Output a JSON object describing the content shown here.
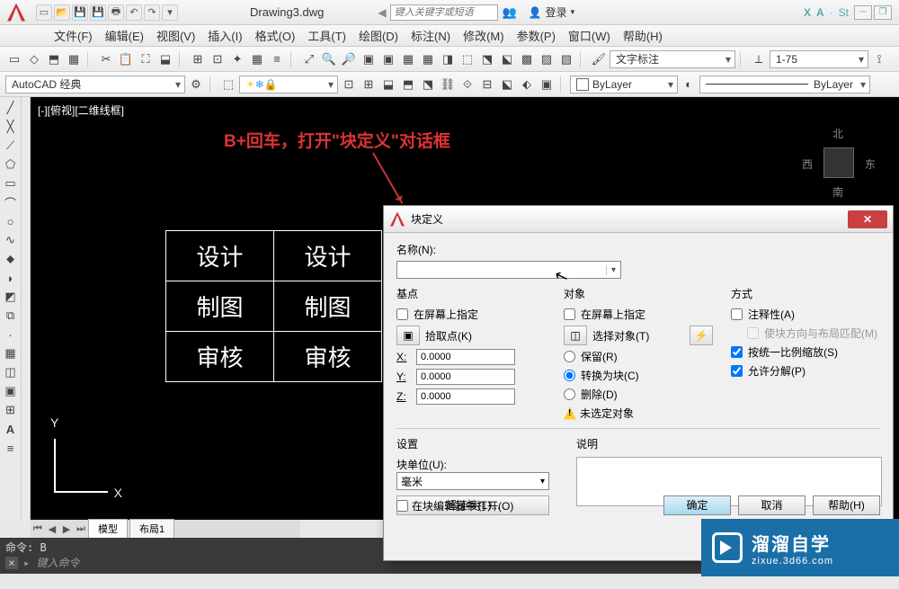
{
  "titlebar": {
    "filename": "Drawing3.dwg",
    "search_placeholder": "键入关键字或短语",
    "login": "登录",
    "exchange_x": "X",
    "exchange_a": "A",
    "sign": "St"
  },
  "menu": {
    "file": "文件(F)",
    "edit": "编辑(E)",
    "view": "视图(V)",
    "insert": "插入(I)",
    "format": "格式(O)",
    "tools": "工具(T)",
    "draw": "绘图(D)",
    "dimension": "标注(N)",
    "modify": "修改(M)",
    "param": "参数(P)",
    "window": "窗口(W)",
    "help": "帮助(H)"
  },
  "workspace": "AutoCAD 经典",
  "textstyle": "文字标注",
  "dimscale": "1-75",
  "layerprops": {
    "bylayer": "ByLayer",
    "linetype": "ByLayer"
  },
  "canvas": {
    "viewlabel": "[-][俯视][二维线框]",
    "redtext": "B+回车，打开\"块定义\"对话框",
    "table": [
      [
        "设计",
        "设计"
      ],
      [
        "制图",
        "制图"
      ],
      [
        "审核",
        "审核"
      ]
    ],
    "axis_y": "Y",
    "axis_x": "X",
    "viewcube": {
      "n": "北",
      "s": "南",
      "e": "东",
      "w": "西"
    }
  },
  "modeltabs": {
    "model": "模型",
    "layout1": "布局1"
  },
  "cmdline": {
    "line1": "命令: B",
    "prompt": "键入命令"
  },
  "dialog": {
    "title": "块定义",
    "name_label": "名称(N):",
    "basepoint": "基点",
    "onscreen": "在屏幕上指定",
    "pickpoint": "拾取点(K)",
    "x_label": "X:",
    "y_label": "Y:",
    "z_label": "Z:",
    "x_val": "0.0000",
    "y_val": "0.0000",
    "z_val": "0.0000",
    "objects": "对象",
    "select_obj": "选择对象(T)",
    "retain": "保留(R)",
    "convert": "转换为块(C)",
    "delete": "删除(D)",
    "nosel": "未选定对象",
    "behavior": "方式",
    "annotative": "注释性(A)",
    "match_orient": "使块方向与布局匹配(M)",
    "uniform": "按统一比例缩放(S)",
    "explode": "允许分解(P)",
    "settings": "设置",
    "unit_label": "块单位(U):",
    "unit_val": "毫米",
    "hyperlink": "超链接(L)...",
    "description": "说明",
    "open_editor": "在块编辑器中打开(O)",
    "ok": "确定",
    "cancel": "取消",
    "help": "帮助(H)"
  },
  "watermark": {
    "big": "溜溜自学",
    "small": "zixue.3d66.com"
  }
}
